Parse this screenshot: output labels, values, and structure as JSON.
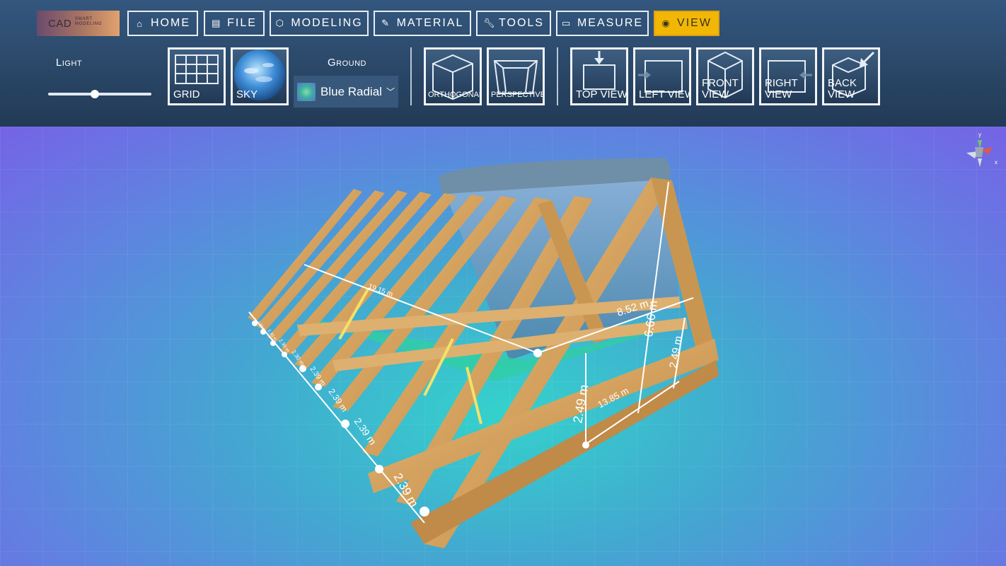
{
  "app": {
    "logo_main": "CAD",
    "logo_line1": "SMART",
    "logo_line2": "MODELING"
  },
  "menu": {
    "home": "HOME",
    "file": "FILE",
    "modeling": "MODELING",
    "material": "MATERIAL",
    "tools": "TOOLS",
    "measure": "MEASURE",
    "view": "VIEW",
    "active": "view",
    "active_color": "#f2b705"
  },
  "view_panel": {
    "light_label": "Light",
    "light_level": 0.45,
    "grid_label": "GRID",
    "sky_label": "SKY",
    "ground_label": "Ground",
    "ground_value": "Blue Radial",
    "orthogonal_label": "ORTHOGONAL",
    "perspective_label": "PERSPECTIVE",
    "top_view_label": "TOP VIEW",
    "left_view_label": "LEFT VIEW",
    "front_view_label": "FRONT VIEW",
    "right_view_label": "RIGHT VIEW",
    "back_view_label": "BACK VIEW"
  },
  "gizmo": {
    "y": "y",
    "x": "x"
  },
  "measurements": {
    "length": "19.15 m",
    "width": "8.52 m",
    "height": "6.66 m",
    "post_front": "2.49 m",
    "post_back": "2.49 m",
    "base": "13.85 m",
    "spacing_1": "2.39 m",
    "spacing_2": "2.39 m",
    "spacing_3": "2.39 m",
    "spacing_4": "2.39 m",
    "spacing_5": "2.30 m",
    "spacing_6": "2.30 m",
    "spacing_7": "2.30 m",
    "spacing_8": "2.30 m"
  }
}
